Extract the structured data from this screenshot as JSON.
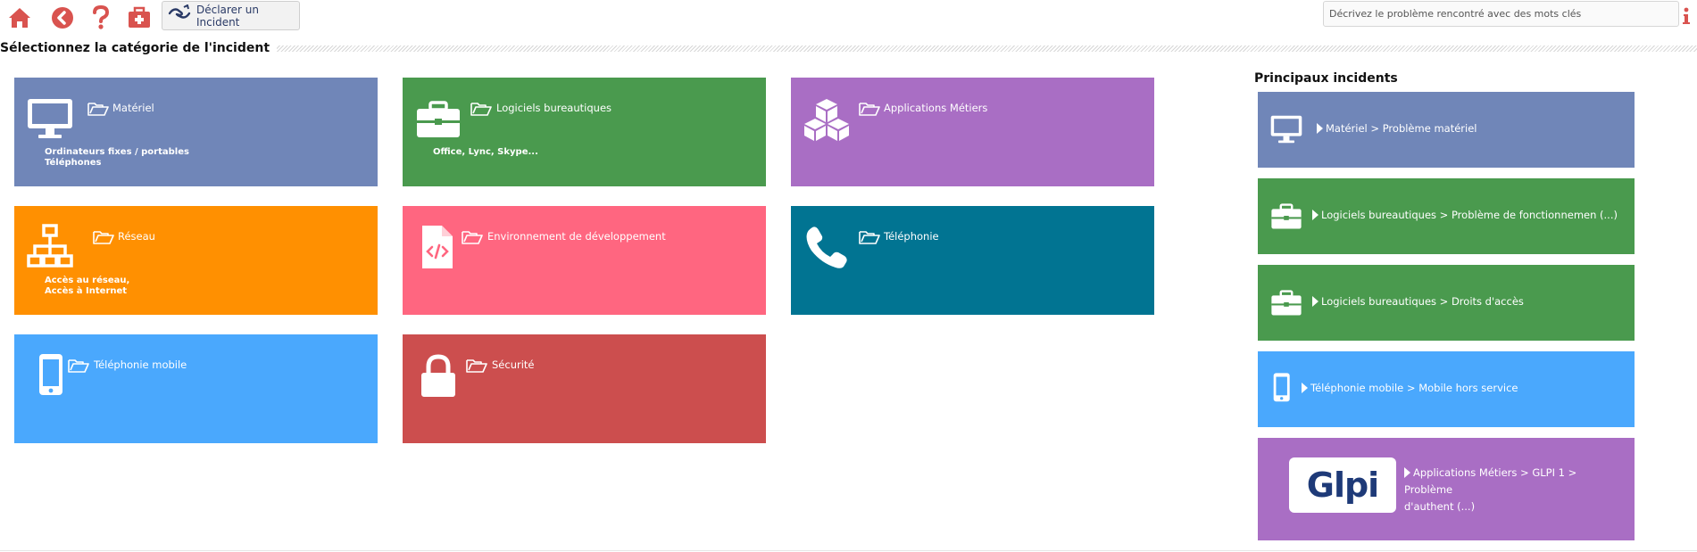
{
  "toolbar": {
    "declare_label": "Déclarer un Incident",
    "icons": [
      "home-icon",
      "back-icon",
      "help-icon",
      "first-aid-kit-icon"
    ],
    "icon_color": "#d9534f"
  },
  "search": {
    "placeholder": "Décrivez le problème rencontré avec des mots clés",
    "value": ""
  },
  "section": {
    "title": "Sélectionnez la catégorie de l'incident"
  },
  "categories": [
    {
      "name": "Matériel",
      "desc1": "Ordinateurs fixes / portables",
      "desc2": "Téléphones",
      "color": "#7086b8",
      "icon": "monitor-icon"
    },
    {
      "name": "Logiciels bureautiques",
      "desc1": "Office, Lync, Skype...",
      "desc2": "",
      "color": "#4a9a4e",
      "icon": "briefcase-icon"
    },
    {
      "name": "Applications Métiers",
      "desc1": "",
      "desc2": "",
      "color": "#a96ec4",
      "icon": "cubes-icon"
    },
    {
      "name": "Réseau",
      "desc1": "Accès au réseau,",
      "desc2": "Accès à Internet",
      "color": "#ff9001",
      "icon": "network-icon"
    },
    {
      "name": "Environnement de développement",
      "desc1": "",
      "desc2": "",
      "color": "#ff6680",
      "icon": "code-file-icon"
    },
    {
      "name": "Téléphonie",
      "desc1": "",
      "desc2": "",
      "color": "#017492",
      "icon": "phone-icon"
    },
    {
      "name": "Téléphonie mobile",
      "desc1": "",
      "desc2": "",
      "color": "#4aa8fd",
      "icon": "mobile-icon"
    },
    {
      "name": "Sécurité",
      "desc1": "",
      "desc2": "",
      "color": "#cc4e4e",
      "icon": "lock-icon"
    }
  ],
  "incidents": {
    "title": "Principaux incidents",
    "items": [
      {
        "label": "Matériel > Problème matériel",
        "label2": "",
        "color": "#7086b8",
        "icon": "monitor-icon"
      },
      {
        "label": "Logiciels bureautiques > Problème de fonctionnemen (...)",
        "label2": "",
        "color": "#4a9a4e",
        "icon": "briefcase-icon"
      },
      {
        "label": "Logiciels bureautiques > Droits d'accès",
        "label2": "",
        "color": "#4a9a4e",
        "icon": "briefcase-icon"
      },
      {
        "label": "Téléphonie mobile > Mobile hors service",
        "label2": "",
        "color": "#4aa8fd",
        "icon": "mobile-icon"
      },
      {
        "label": "Applications Métiers > GLPI 1 > Problème",
        "label2": "d'authent (...)",
        "color": "#a96ec4",
        "icon": "glpi-logo",
        "logo_text": "Glpi"
      }
    ]
  }
}
